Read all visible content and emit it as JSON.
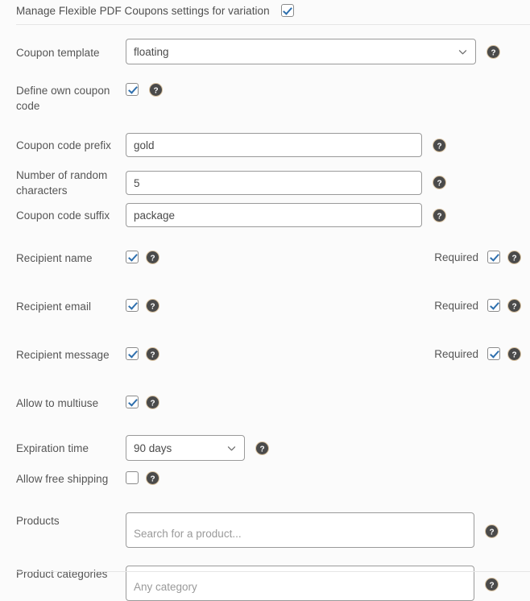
{
  "header": {
    "label": "Manage Flexible PDF Coupons settings for variation",
    "checked": true
  },
  "rows": {
    "coupon_template": {
      "label": "Coupon template",
      "value": "floating",
      "help": "help-icon"
    },
    "define_own_coupon_code": {
      "label": "Define own coupon code",
      "checked": true
    },
    "coupon_code_prefix": {
      "label": "Coupon code prefix",
      "value": "gold",
      "placeholder": ""
    },
    "number_of_random_characters": {
      "label": "Number of random characters",
      "value": "5",
      "placeholder": ""
    },
    "coupon_code_suffix": {
      "label": "Coupon code suffix",
      "value": "package",
      "placeholder": ""
    },
    "recipient_name": {
      "label": "Recipient name",
      "checked": true,
      "required_label": "Required",
      "required_checked": true
    },
    "recipient_email": {
      "label": "Recipient email",
      "checked": true,
      "required_label": "Required",
      "required_checked": true
    },
    "recipient_message": {
      "label": "Recipient message",
      "checked": true,
      "required_label": "Required",
      "required_checked": true
    },
    "allow_to_multiuse": {
      "label": "Allow to multiuse",
      "checked": true
    },
    "expiration_time": {
      "label": "Expiration time",
      "value": "90 days"
    },
    "allow_free_shipping": {
      "label": "Allow free shipping",
      "checked": false
    },
    "products": {
      "label": "Products",
      "placeholder": "Search for a product..."
    },
    "product_categories": {
      "label": "Product categories",
      "placeholder": "Any category"
    }
  },
  "colors": {
    "background": "#fbfbfb",
    "text": "#555555",
    "check_accent": "#2e6fad",
    "border": "#9a9a9a",
    "divider": "#e6e6e6",
    "help_icon_bg": "#4a4a4a"
  }
}
